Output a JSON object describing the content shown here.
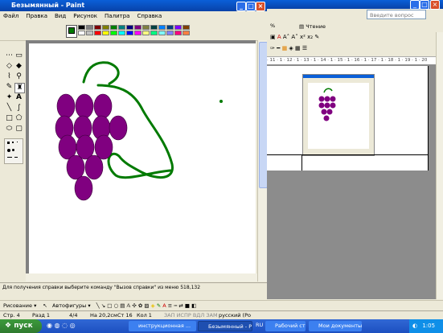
{
  "paint": {
    "title": "Безымянный - Paint",
    "menu": [
      "Файл",
      "Правка",
      "Вид",
      "Рисунок",
      "Палитра",
      "Справка"
    ],
    "palette": [
      "#000000",
      "#808080",
      "#800000",
      "#808000",
      "#008000",
      "#008080",
      "#000080",
      "#800080",
      "#808040",
      "#004040",
      "#0080ff",
      "#004080",
      "#8000ff",
      "#804000",
      "#ffffff",
      "#c0c0c0",
      "#ff0000",
      "#ffff00",
      "#00ff00",
      "#00ffff",
      "#0000ff",
      "#ff00ff",
      "#ffff80",
      "#00ff80",
      "#80ffff",
      "#8080ff",
      "#ff0080",
      "#ff8040"
    ],
    "status": "Для получения справки выберите команду \"Вызов справки\" из меню 518,132"
  },
  "word": {
    "help_placeholder": "Введите вопрос",
    "reading_label": "Чтение",
    "zoom": "%",
    "ruler": "· 11 · 1 · 12 · 1 · 13 · 1 · 14 · 1 · 15 · 1 · 16 · 1 · 17 · 1 · 18 · 1 · 19 · 1 · 20",
    "draw_label": "Рисование",
    "autoshapes_label": "Автофигуры",
    "status": {
      "page": "Стр. 4",
      "section": "Разд 1",
      "pages": "4/4",
      "at": "На 20,2см",
      "line": "Ст 16",
      "col": "Кол 1",
      "flags": "ЗАП  ИСПР  ВДЛ  ЗАМ",
      "language": "русский (Ро"
    }
  },
  "taskbar": {
    "start": "пуск",
    "tasks": [
      "инструкционная ...",
      "Безымянный - Paint",
      "Рабочий стол",
      "Мои документы"
    ],
    "lang": "RU",
    "time": "1:05"
  },
  "colors": {
    "grape": "#800080",
    "vine": "#007a00",
    "title_blue": "#0a5fd8"
  }
}
